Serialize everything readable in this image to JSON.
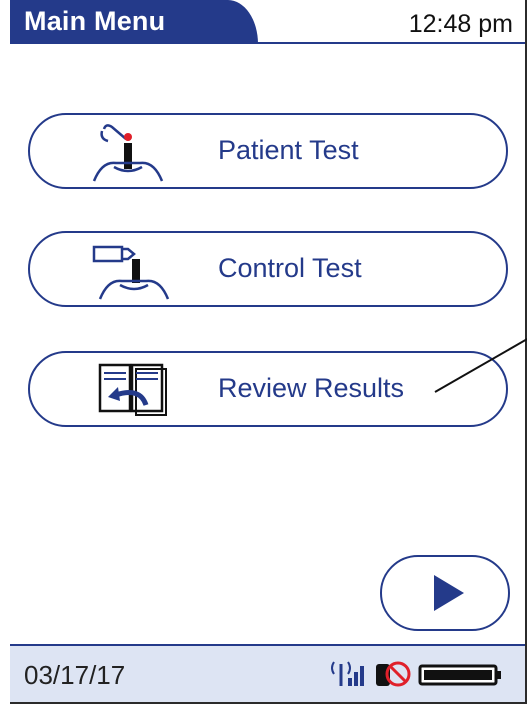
{
  "header": {
    "title": "Main Menu",
    "time": "12:48 pm"
  },
  "menu": {
    "items": [
      {
        "label": "Patient Test",
        "icon": "patient-test-icon"
      },
      {
        "label": "Control Test",
        "icon": "control-test-icon"
      },
      {
        "label": "Review Results",
        "icon": "review-results-icon"
      }
    ]
  },
  "navigation": {
    "next_icon": "play-arrow-icon"
  },
  "status_bar": {
    "date": "03/17/17",
    "icons": [
      "wireless-signal-icon",
      "no-connection-icon",
      "battery-icon"
    ]
  },
  "colors": {
    "primary": "#243a8a",
    "status_background": "#dde4f3",
    "drop": "#e0202a"
  }
}
